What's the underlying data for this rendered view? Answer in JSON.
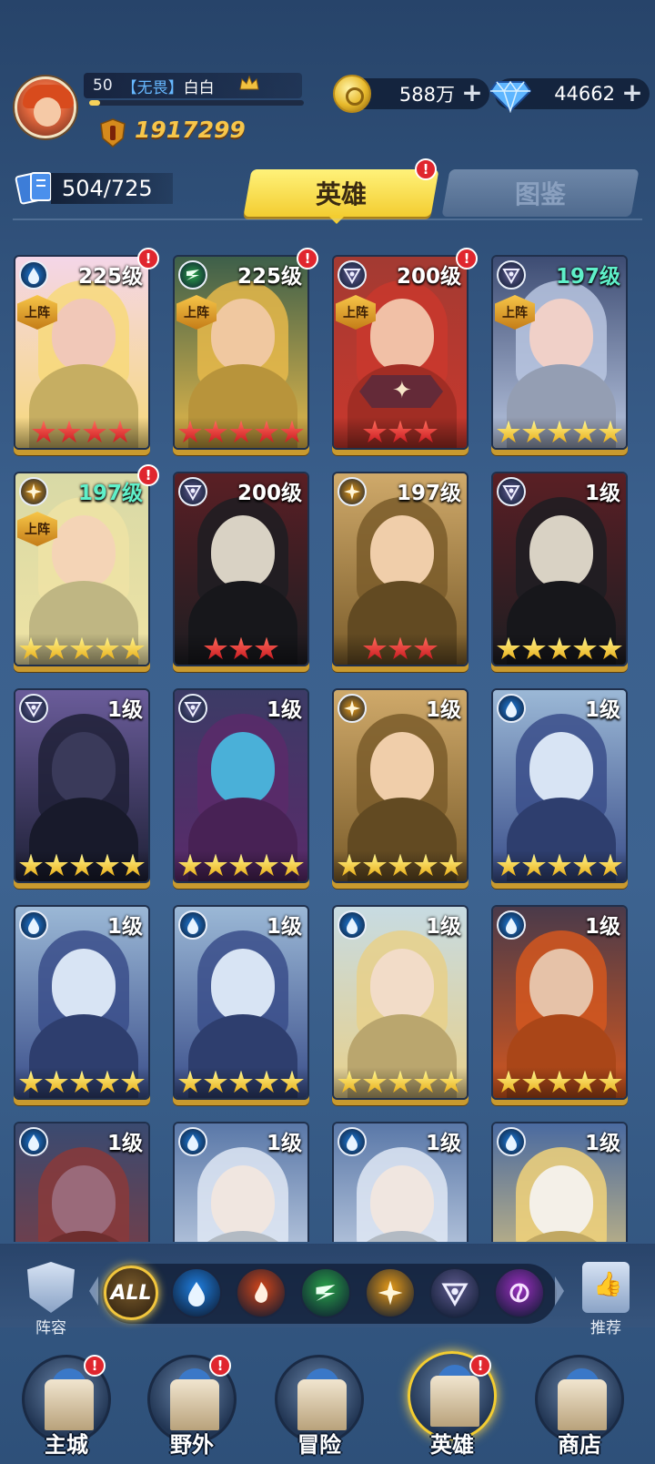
{
  "player": {
    "level": "50",
    "guild": "【无畏】",
    "name": "白白",
    "exp_fraction": 0.05,
    "power": "1917299"
  },
  "resources": {
    "gold": "588万",
    "diamonds": "44662"
  },
  "hero_count": "504/725",
  "tabs": {
    "heroes": "英雄",
    "handbook": "图鉴"
  },
  "deploy_label": "上阵",
  "badge_mark": "!",
  "heroes": [
    {
      "level": "225级",
      "element": "water",
      "stars": 4,
      "star_color": "red",
      "deployed": true,
      "alert": true,
      "level_color": "white"
    },
    {
      "level": "225级",
      "element": "wind",
      "stars": 5,
      "star_color": "red",
      "deployed": true,
      "alert": true,
      "level_color": "white"
    },
    {
      "level": "200级",
      "element": "dark",
      "stars": 3,
      "star_color": "red",
      "deployed": true,
      "alert": true,
      "level_color": "white"
    },
    {
      "level": "197级",
      "element": "dark",
      "stars": 5,
      "star_color": "gold",
      "deployed": true,
      "alert": false,
      "level_color": "teal"
    },
    {
      "level": "197级",
      "element": "light",
      "stars": 5,
      "star_color": "gold",
      "deployed": true,
      "alert": true,
      "level_color": "teal"
    },
    {
      "level": "200级",
      "element": "dark",
      "stars": 3,
      "star_color": "red",
      "deployed": false,
      "alert": false,
      "level_color": "white"
    },
    {
      "level": "197级",
      "element": "light",
      "stars": 3,
      "star_color": "red",
      "deployed": false,
      "alert": false,
      "level_color": "white"
    },
    {
      "level": "1级",
      "element": "dark",
      "stars": 5,
      "star_color": "gold",
      "deployed": false,
      "alert": false,
      "level_color": "white"
    },
    {
      "level": "1级",
      "element": "dark",
      "stars": 5,
      "star_color": "gold",
      "deployed": false,
      "alert": false,
      "level_color": "white"
    },
    {
      "level": "1级",
      "element": "dark",
      "stars": 5,
      "star_color": "gold",
      "deployed": false,
      "alert": false,
      "level_color": "white"
    },
    {
      "level": "1级",
      "element": "light",
      "stars": 5,
      "star_color": "gold",
      "deployed": false,
      "alert": false,
      "level_color": "white"
    },
    {
      "level": "1级",
      "element": "water",
      "stars": 5,
      "star_color": "gold",
      "deployed": false,
      "alert": false,
      "level_color": "white"
    },
    {
      "level": "1级",
      "element": "water",
      "stars": 5,
      "star_color": "gold",
      "deployed": false,
      "alert": false,
      "level_color": "white"
    },
    {
      "level": "1级",
      "element": "water",
      "stars": 5,
      "star_color": "gold",
      "deployed": false,
      "alert": false,
      "level_color": "white"
    },
    {
      "level": "1级",
      "element": "water",
      "stars": 5,
      "star_color": "gold",
      "deployed": false,
      "alert": false,
      "level_color": "white"
    },
    {
      "level": "1级",
      "element": "water",
      "stars": 5,
      "star_color": "gold",
      "deployed": false,
      "alert": false,
      "level_color": "white"
    },
    {
      "level": "1级",
      "element": "water",
      "stars": 0,
      "star_color": "gold",
      "deployed": false,
      "alert": false,
      "level_color": "white"
    },
    {
      "level": "1级",
      "element": "water",
      "stars": 0,
      "star_color": "gold",
      "deployed": false,
      "alert": false,
      "level_color": "white"
    },
    {
      "level": "1级",
      "element": "water",
      "stars": 0,
      "star_color": "gold",
      "deployed": false,
      "alert": false,
      "level_color": "white"
    },
    {
      "level": "1级",
      "element": "water",
      "stars": 0,
      "star_color": "gold",
      "deployed": false,
      "alert": false,
      "level_color": "white"
    }
  ],
  "filter": {
    "team_label": "阵容",
    "recommend_label": "推荐",
    "all_label": "ALL",
    "elements": [
      "water",
      "fire",
      "wind",
      "light",
      "dark",
      "chaos"
    ]
  },
  "nav": [
    {
      "label": "主城",
      "alert": true,
      "active": false
    },
    {
      "label": "野外",
      "alert": true,
      "active": false
    },
    {
      "label": "冒险",
      "alert": false,
      "active": false
    },
    {
      "label": "英雄",
      "alert": true,
      "active": true
    },
    {
      "label": "商店",
      "alert": false,
      "active": false
    }
  ],
  "colors": {
    "water": "#1f7fe0",
    "wind": "#2aa24a",
    "dark": "#5e5a8e",
    "light": "#e69a18",
    "fire": "#d2461a",
    "chaos": "#9a2fbf",
    "accent_gold": "#f3cd31",
    "alert_red": "#e0262e"
  }
}
